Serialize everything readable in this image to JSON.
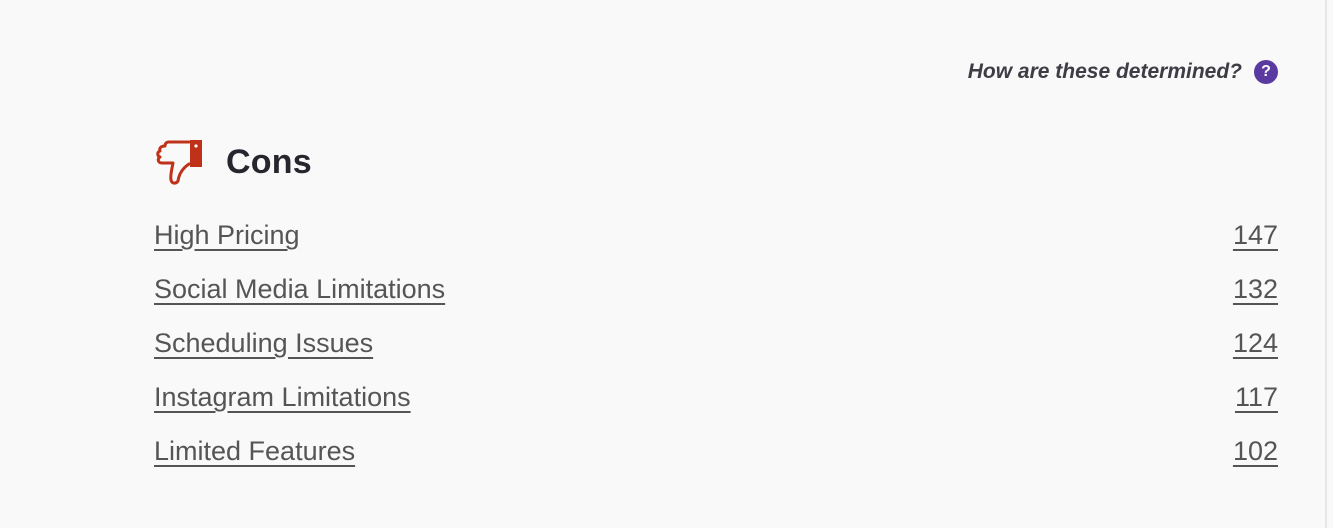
{
  "help": {
    "text": "How are these determined?",
    "icon": "question-circle-icon",
    "glyph": "?",
    "color": "#5a3aa0"
  },
  "cons": {
    "title": "Cons",
    "icon": "thumbs-down-icon",
    "icon_color": "#c0311a",
    "items": [
      {
        "label": "High Pricing",
        "count": "147"
      },
      {
        "label": "Social Media Limitations",
        "count": "132"
      },
      {
        "label": "Scheduling Issues",
        "count": "124"
      },
      {
        "label": "Instagram Limitations",
        "count": "117"
      },
      {
        "label": "Limited Features",
        "count": "102"
      }
    ]
  }
}
